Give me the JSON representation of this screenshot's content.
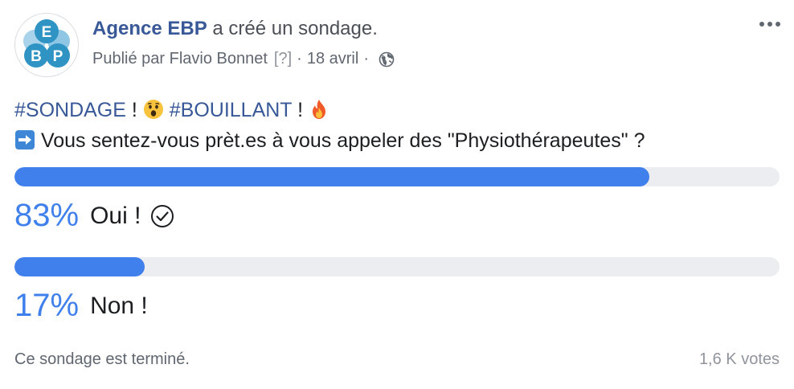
{
  "header": {
    "author_name": "Agence EBP",
    "author_action": "a créé un sondage.",
    "published_by": "Publié par Flavio Bonnet",
    "unknown_marker": "[?]",
    "separator": "·",
    "date": "18 avril",
    "privacy_icon": "globe-icon",
    "more_icon": "more-dots-icon",
    "avatar_letters": [
      "E",
      "B",
      "P"
    ]
  },
  "post": {
    "line1": {
      "hashtag1": "#SONDAGE",
      "after_hashtag1": " !",
      "emoji1": "surprised-face-emoji",
      "hashtag2": "#BOUILLANT",
      "after_hashtag2": " !",
      "emoji2": "fire-emoji"
    },
    "line2": {
      "emoji": "right-arrow-emoji",
      "question": "Vous sentez-vous prèt.es à vous appeler des \"Physiothérapeutes\" ?"
    }
  },
  "poll": {
    "options": [
      {
        "percent_label": "83%",
        "percent": 83,
        "label": "Oui !",
        "voted": true
      },
      {
        "percent_label": "17%",
        "percent": 17,
        "label": "Non !",
        "voted": false
      }
    ],
    "status": "Ce sondage est terminé.",
    "votes": "1,6 K votes"
  },
  "colors": {
    "accent": "#4080ec",
    "link": "#385898",
    "track": "#ebedf0"
  }
}
